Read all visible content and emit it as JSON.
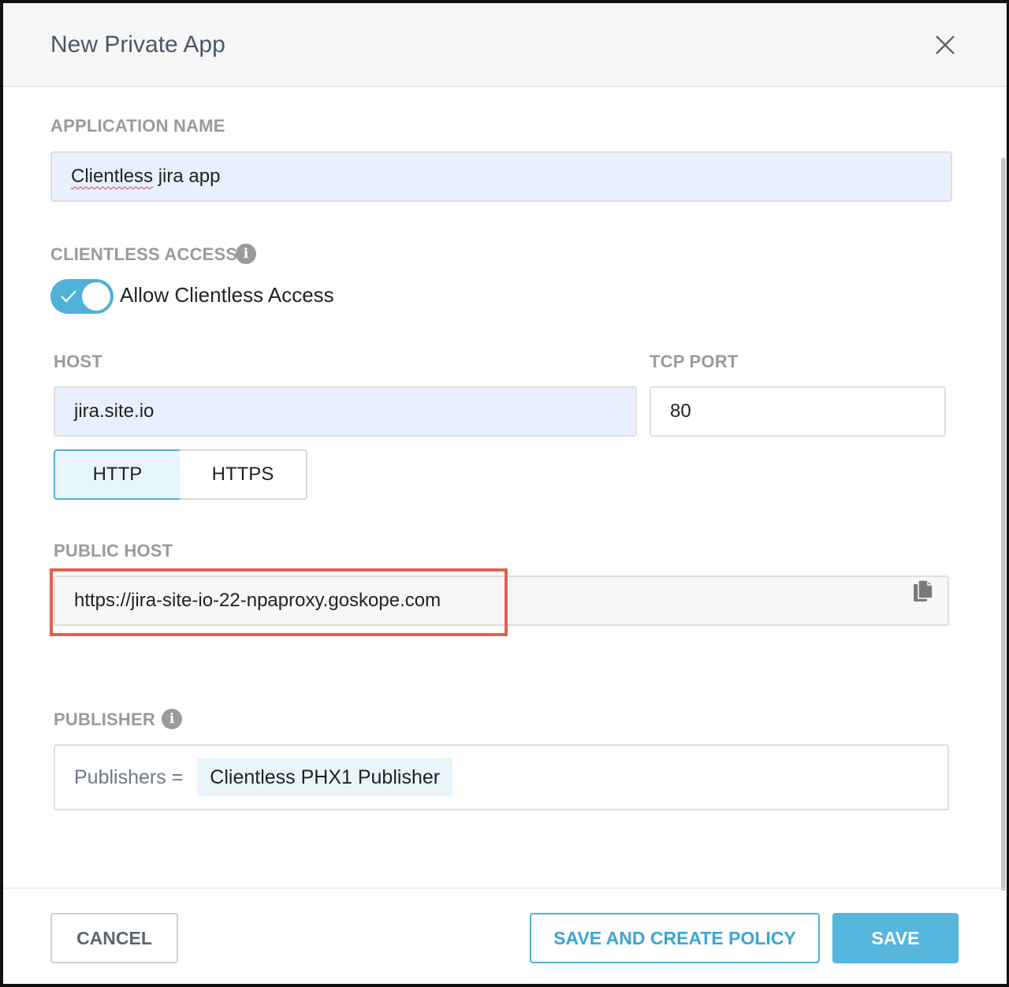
{
  "dialog": {
    "title": "New Private App",
    "close_icon": "close-icon"
  },
  "application_name": {
    "label": "APPLICATION NAME",
    "value_misspelled": "Clientless",
    "value_rest": " jira app"
  },
  "clientless_access": {
    "label": "CLIENTLESS ACCESS",
    "info_icon": "info-icon",
    "toggle_on": true,
    "toggle_label": "Allow Clientless Access"
  },
  "host": {
    "label": "HOST",
    "value": "jira.site.io"
  },
  "tcp_port": {
    "label": "TCP PORT",
    "value": "80"
  },
  "protocol": {
    "options": [
      "HTTP",
      "HTTPS"
    ],
    "selected": "HTTP"
  },
  "public_host": {
    "label": "PUBLIC HOST",
    "value": "https://jira-site-io-22-npaproxy.goskope.com",
    "copy_icon": "copy-icon"
  },
  "publisher": {
    "label": "PUBLISHER",
    "info_icon": "info-icon",
    "prefix": "Publishers =",
    "chips": [
      "Clientless PHX1 Publisher"
    ]
  },
  "footer": {
    "cancel_label": "CANCEL",
    "save_and_create_label": "SAVE AND CREATE POLICY",
    "save_label": "SAVE"
  },
  "colors": {
    "accent": "#4fb0d8",
    "highlight_border": "#e06153",
    "filled_input": "#e8f0fe"
  }
}
